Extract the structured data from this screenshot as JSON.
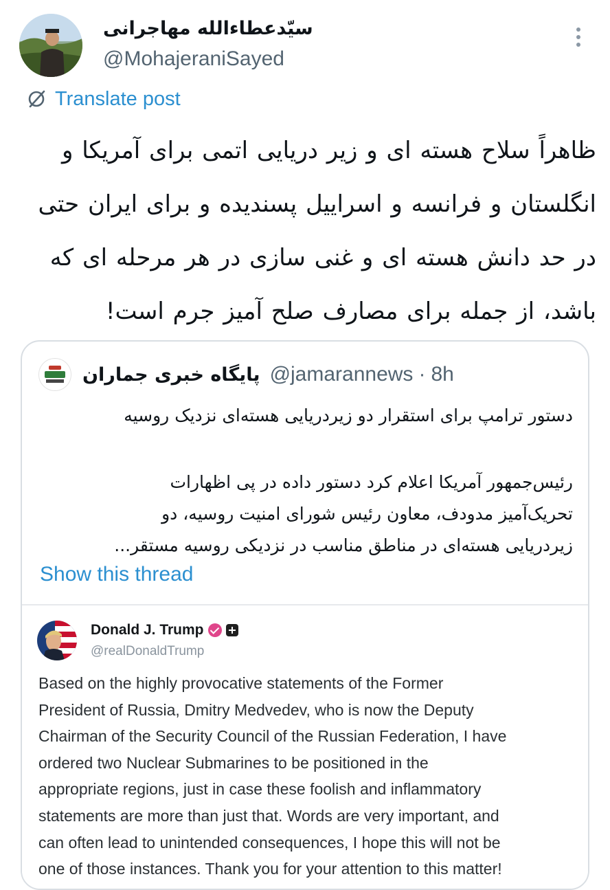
{
  "author": {
    "display_name": "سیّدعطاءالله مهاجرانی",
    "handle": "@MohajeraniSayed"
  },
  "translate": {
    "label": "Translate post"
  },
  "post": {
    "lines": [
      "ظاهراً سلاح هسته ای و زیر دریایی اتمی برای آمریکا و",
      "انگلستان و فرانسه و اسراییل پسندیده و برای ایران حتی",
      "در حد دانش هسته ای و غنی سازی  در هر مرحله ای که",
      "باشد، از جمله برای مصارف صلح آمیز جرم است!"
    ]
  },
  "quote": {
    "name": "پایگاه خبری جماران",
    "handle": "@jamarannews",
    "separator": "·",
    "time": "8h",
    "title": "دستور ترامپ برای استقرار دو زیردریایی هسته‌ای نزدیک روسیه",
    "body_lines": [
      "رئیس‌جمهور آمریکا اعلام کرد دستور داده در پی اظهارات",
      "تحریک‌آمیز مدودف، معاون رئیس شورای امنیت روسیه، دو",
      "زیردریایی هسته‌ای در مناطق مناسب در نزدیکی روسیه مستقر..."
    ],
    "show_thread": "Show this thread"
  },
  "embedded": {
    "name": "Donald J. Trump",
    "handle": "@realDonaldTrump",
    "lines": [
      "Based on the highly provocative statements of the Former",
      "President of Russia, Dmitry Medvedev, who is now the Deputy",
      "Chairman of the Security Council of the Russian Federation, I have",
      "ordered two Nuclear Submarines to be positioned in the",
      "appropriate regions, just in case these foolish and inflammatory",
      "statements are more than just that. Words are very important, and",
      "can often lead to unintended consequences, I hope this will not be",
      "one of those instances. Thank you for your attention to this matter!"
    ]
  },
  "icons": {
    "more": "more-dots-icon",
    "translate": "translate-icon",
    "verified": "verified-badge-icon",
    "affiliation": "plus-badge-icon"
  },
  "colors": {
    "link": "#2b8fd0",
    "secondary_text": "#536471",
    "card_border": "#d9dee3"
  }
}
